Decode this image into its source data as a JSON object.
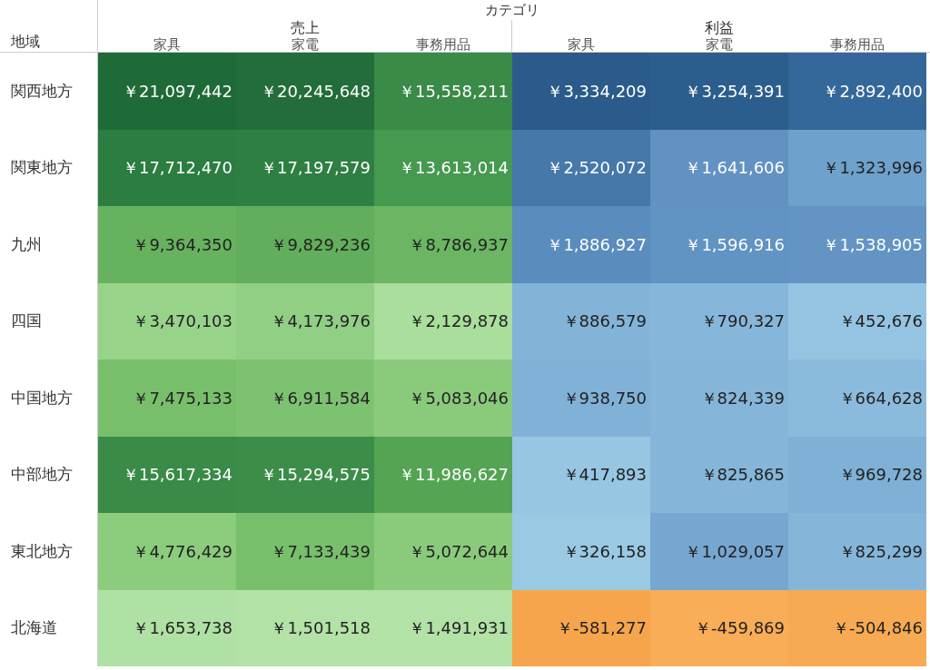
{
  "header": {
    "row_label": "地域",
    "column_title": "カテゴリ"
  },
  "groups": [
    {
      "label": "売上",
      "categories": [
        "家具",
        "家電",
        "事務用品"
      ]
    },
    {
      "label": "利益",
      "categories": [
        "家具",
        "家電",
        "事務用品"
      ]
    }
  ],
  "rows": [
    {
      "region": "関西地方",
      "cells": [
        {
          "value": "￥21,097,442",
          "color": "#1f6b38"
        },
        {
          "value": "￥20,245,648",
          "color": "#226d3a"
        },
        {
          "value": "￥15,558,211",
          "color": "#3a8a48"
        },
        {
          "value": "￥3,334,209",
          "color": "#2b5b8a"
        },
        {
          "value": "￥3,254,391",
          "color": "#2c5e8d"
        },
        {
          "value": "￥2,892,400",
          "color": "#35689a"
        }
      ]
    },
    {
      "region": "関東地方",
      "cells": [
        {
          "value": "￥17,712,470",
          "color": "#2b7d40"
        },
        {
          "value": "￥17,197,579",
          "color": "#2e7f42"
        },
        {
          "value": "￥13,613,014",
          "color": "#469a50"
        },
        {
          "value": "￥2,520,072",
          "color": "#4678aa"
        },
        {
          "value": "￥1,641,606",
          "color": "#6292c2"
        },
        {
          "value": "￥1,323,996",
          "color": "#6ea1cc"
        }
      ]
    },
    {
      "region": "九州",
      "cells": [
        {
          "value": "￥9,364,350",
          "color": "#67b25f"
        },
        {
          "value": "￥9,829,236",
          "color": "#62ae5c"
        },
        {
          "value": "￥8,786,937",
          "color": "#6bb563"
        },
        {
          "value": "￥1,886,927",
          "color": "#5a8cbd"
        },
        {
          "value": "￥1,596,916",
          "color": "#6193c3"
        },
        {
          "value": "￥1,538,905",
          "color": "#6394c4"
        }
      ]
    },
    {
      "region": "四国",
      "cells": [
        {
          "value": "￥3,470,103",
          "color": "#98d38a"
        },
        {
          "value": "￥4,173,976",
          "color": "#91cf85"
        },
        {
          "value": "￥2,129,878",
          "color": "#a9de9d"
        },
        {
          "value": "￥886,579",
          "color": "#83b4d8"
        },
        {
          "value": "￥790,327",
          "color": "#86b7da"
        },
        {
          "value": "￥452,676",
          "color": "#94c4e1"
        }
      ]
    },
    {
      "region": "中国地方",
      "cells": [
        {
          "value": "￥7,475,133",
          "color": "#78bf6c"
        },
        {
          "value": "￥6,911,584",
          "color": "#7dc270"
        },
        {
          "value": "￥5,083,046",
          "color": "#8acb7b"
        },
        {
          "value": "￥938,750",
          "color": "#80b2d7"
        },
        {
          "value": "￥824,339",
          "color": "#85b6d9"
        },
        {
          "value": "￥664,628",
          "color": "#8bbbdc"
        }
      ]
    },
    {
      "region": "中部地方",
      "cells": [
        {
          "value": "￥15,617,334",
          "color": "#3a8a48"
        },
        {
          "value": "￥15,294,575",
          "color": "#3c8c4a"
        },
        {
          "value": "￥11,986,627",
          "color": "#54a453"
        },
        {
          "value": "￥417,893",
          "color": "#96c6e2"
        },
        {
          "value": "￥825,865",
          "color": "#85b6d9"
        },
        {
          "value": "￥969,728",
          "color": "#7fb0d5"
        }
      ]
    },
    {
      "region": "東北地方",
      "cells": [
        {
          "value": "￥4,776,429",
          "color": "#8ccc7d"
        },
        {
          "value": "￥7,133,439",
          "color": "#78bf6c"
        },
        {
          "value": "￥5,072,644",
          "color": "#8acb7b"
        },
        {
          "value": "￥326,158",
          "color": "#9ac9e3"
        },
        {
          "value": "￥1,029,057",
          "color": "#76a7d0"
        },
        {
          "value": "￥825,299",
          "color": "#85b6d9"
        }
      ]
    },
    {
      "region": "北海道",
      "cells": [
        {
          "value": "￥1,653,738",
          "color": "#b0e1a4"
        },
        {
          "value": "￥1,501,518",
          "color": "#b2e2a6"
        },
        {
          "value": "￥1,491,931",
          "color": "#b2e2a6"
        },
        {
          "value": "￥-581,277",
          "color": "#f6a54c"
        },
        {
          "value": "￥-459,869",
          "color": "#f8ad56"
        },
        {
          "value": "￥-504,846",
          "color": "#f8aa52"
        }
      ]
    }
  ]
}
